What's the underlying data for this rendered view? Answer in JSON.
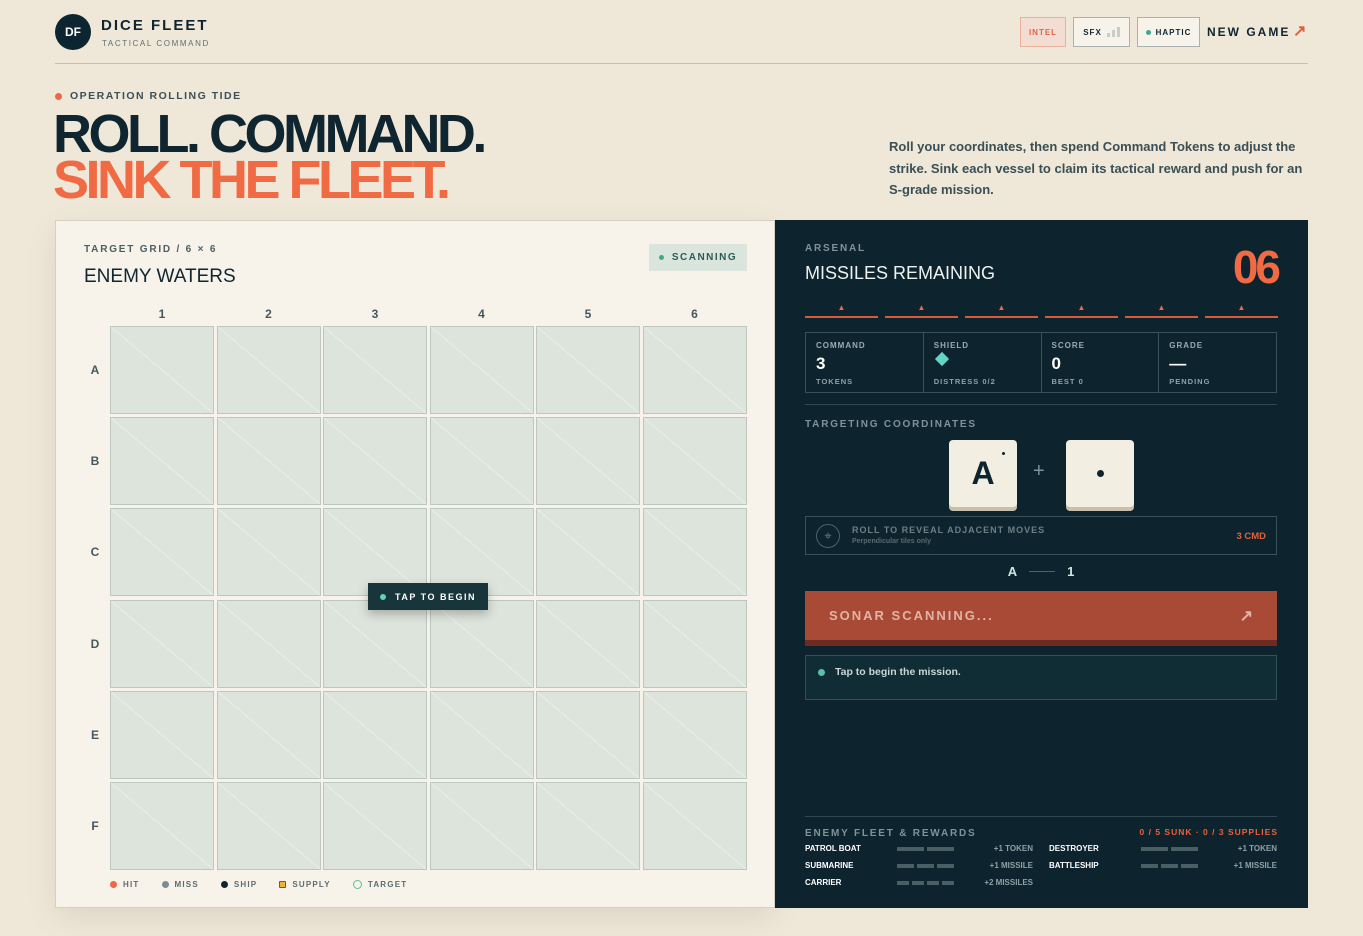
{
  "header": {
    "logo": "DF",
    "title": "DICE FLEET",
    "subtitle": "TACTICAL COMMAND",
    "intel_label": "INTEL",
    "sfx_label": "SFX",
    "haptic_label": "HAPTIC",
    "new_game_label": "NEW GAME",
    "new_game_arrow": "↗"
  },
  "hero": {
    "operation": "OPERATION ROLLING TIDE",
    "line1": "ROLL. COMMAND.",
    "line2": "SINK THE FLEET.",
    "description": "Roll your coordinates, then spend Command Tokens to adjust the strike. Sink each vessel to claim its tactical reward and push for an S-grade mission."
  },
  "grid_panel": {
    "label": "TARGET GRID / 6 × 6",
    "title": "ENEMY WATERS",
    "status": "SCANNING",
    "columns": [
      "1",
      "2",
      "3",
      "4",
      "5",
      "6"
    ],
    "rows": [
      "A",
      "B",
      "C",
      "D",
      "E",
      "F"
    ],
    "tap_label": "TAP TO BEGIN",
    "legend": [
      {
        "label": "HIT",
        "color": "#ef6846",
        "shape": "dot"
      },
      {
        "label": "MISS",
        "color": "#7d8c90",
        "shape": "dot"
      },
      {
        "label": "SHIP",
        "color": "#0f2530",
        "shape": "dot"
      },
      {
        "label": "SUPPLY",
        "color": "#f0b23d",
        "shape": "square"
      },
      {
        "label": "TARGET",
        "color": "#5fbf92",
        "shape": "ring"
      }
    ]
  },
  "arsenal": {
    "label": "ARSENAL",
    "title": "MISSILES REMAINING",
    "count": "06",
    "missiles": 6,
    "missile_icon": "▲",
    "stats": [
      {
        "label": "COMMAND",
        "value": "3",
        "sub": "TOKENS"
      },
      {
        "label": "SHIELD",
        "value": "",
        "icon": "diamond-icon",
        "sub": "DISTRESS 0/2"
      },
      {
        "label": "SCORE",
        "value": "0",
        "sub": "BEST 0"
      },
      {
        "label": "GRADE",
        "value": "—",
        "sub": "PENDING"
      }
    ],
    "targeting_label": "TARGETING COORDINATES",
    "die_letter": "A",
    "plus": "+",
    "adjacent": {
      "title": "ROLL TO REVEAL ADJACENT MOVES",
      "sub": "Perpendicular tiles only",
      "cost": "3 CMD",
      "icon": "⌖"
    },
    "coord_row": "A",
    "coord_col": "1",
    "fire_label": "SONAR SCANNING...",
    "fire_arrow": "↗",
    "message": "Tap to begin the mission."
  },
  "fleet": {
    "label": "ENEMY FLEET & REWARDS",
    "count": "0 / 5 SUNK · 0 / 3 SUPPLIES",
    "ships": [
      {
        "name": "PATROL BOAT",
        "size": 2,
        "reward": "+1 TOKEN"
      },
      {
        "name": "DESTROYER",
        "size": 2,
        "reward": "+1 TOKEN"
      },
      {
        "name": "SUBMARINE",
        "size": 3,
        "reward": "+1 MISSILE"
      },
      {
        "name": "BATTLESHIP",
        "size": 3,
        "reward": "+1 MISSILE"
      },
      {
        "name": "CARRIER",
        "size": 4,
        "reward": "+2 MISSILES"
      }
    ]
  },
  "colors": {
    "background": "#efe7d7",
    "navy": "#0d242e",
    "accent": "#f06a44",
    "cell": "#dce4dc"
  }
}
